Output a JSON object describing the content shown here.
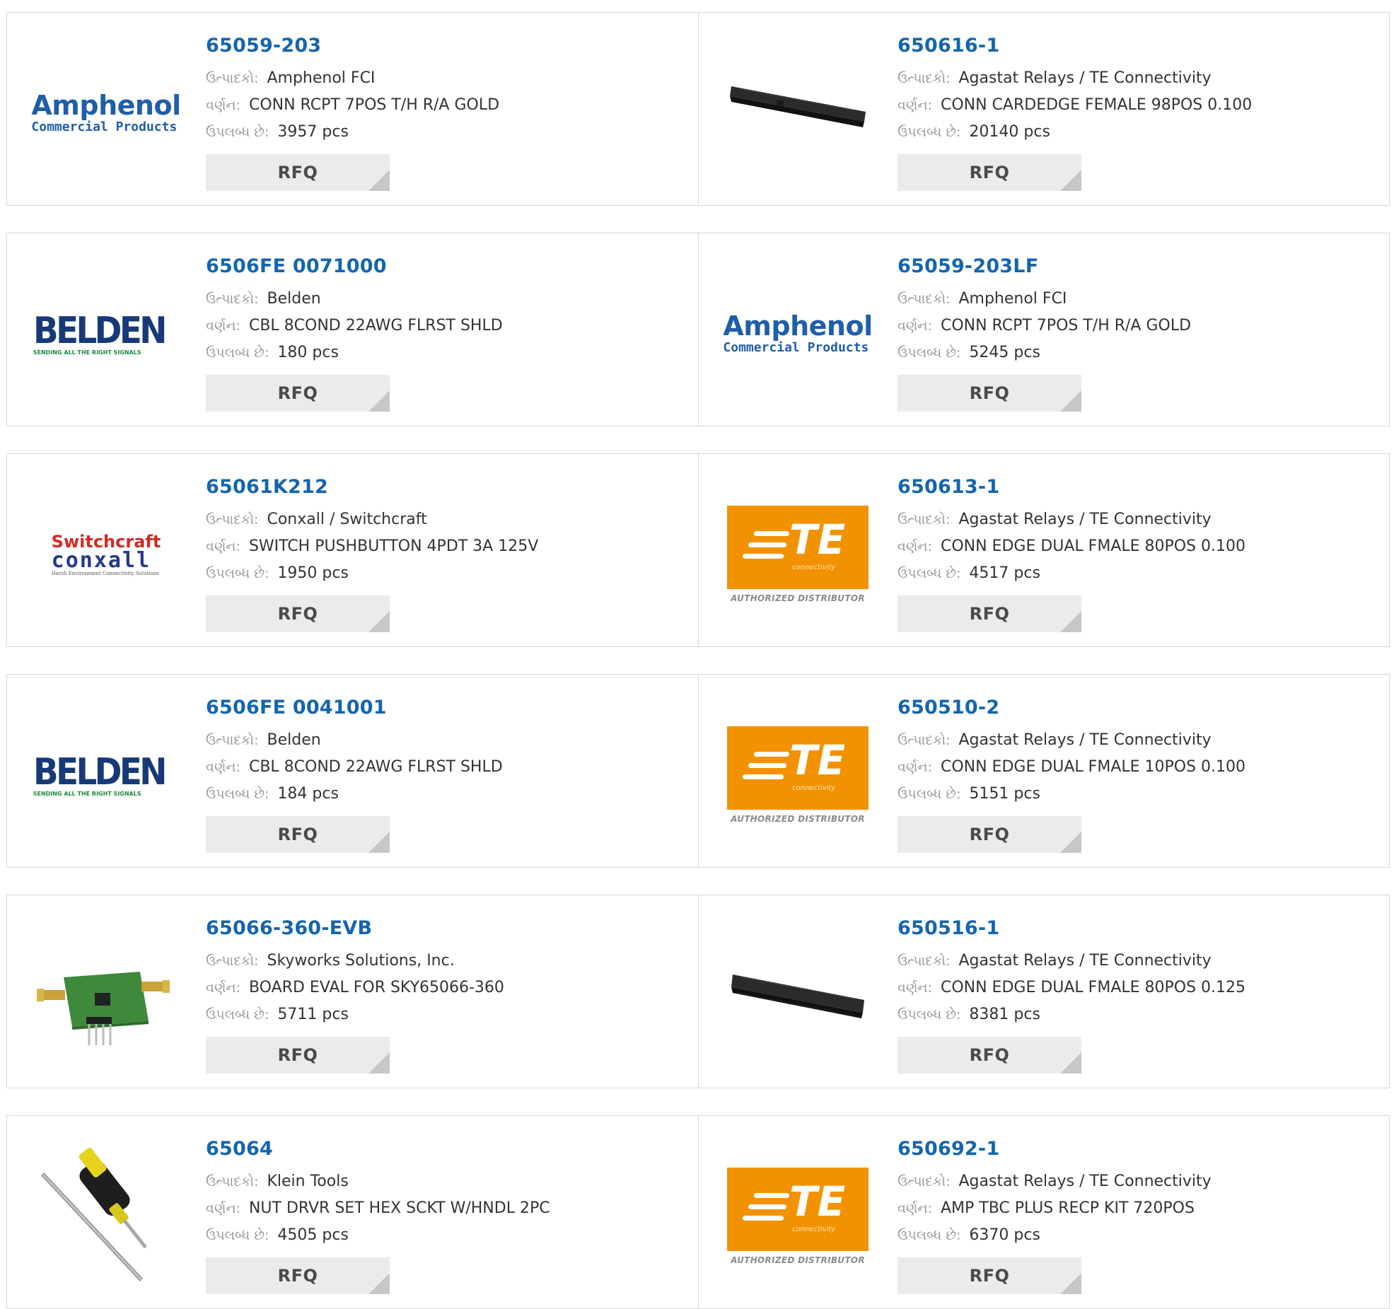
{
  "labels": {
    "manufacturer": "ઉત્પાદકો:",
    "description": "વર્ણન:",
    "availability": "ઉપલબ્ધ છે:",
    "rfq": "RFQ"
  },
  "logos": {
    "amphenol": {
      "line1": "Amphenol",
      "line2": "Commercial Products"
    },
    "belden": {
      "line1": "BELDEN",
      "line2": "SENDING ALL THE RIGHT SIGNALS"
    },
    "switchcraft": {
      "line1": "Switchcraft",
      "line2": "conxall",
      "line3": "Harsh Environment Connectivity Solutions"
    },
    "te": {
      "line1": "TE",
      "line2": "connectivity",
      "line3": "AUTHORIZED DISTRIBUTOR"
    }
  },
  "colors": {
    "link": "#1565ad",
    "te_orange": "#f39200"
  },
  "products": [
    {
      "part": "65059-203",
      "manufacturer": "Amphenol FCI",
      "description": "CONN RCPT 7POS T/H R/A GOLD",
      "stock": "3957 pcs",
      "image": "amphenol-logo"
    },
    {
      "part": "650616-1",
      "manufacturer": "Agastat Relays / TE Connectivity",
      "description": "CONN CARDEDGE FEMALE 98POS 0.100",
      "stock": "20140 pcs",
      "image": "card-edge-connector-photo"
    },
    {
      "part": "6506FE 0071000",
      "manufacturer": "Belden",
      "description": "CBL 8COND 22AWG FLRST SHLD",
      "stock": "180 pcs",
      "image": "belden-logo"
    },
    {
      "part": "65059-203LF",
      "manufacturer": "Amphenol FCI",
      "description": "CONN RCPT 7POS T/H R/A GOLD",
      "stock": "5245 pcs",
      "image": "amphenol-logo"
    },
    {
      "part": "65061K212",
      "manufacturer": "Conxall / Switchcraft",
      "description": "SWITCH PUSHBUTTON 4PDT 3A 125V",
      "stock": "1950 pcs",
      "image": "switchcraft-logo"
    },
    {
      "part": "650613-1",
      "manufacturer": "Agastat Relays / TE Connectivity",
      "description": "CONN EDGE DUAL FMALE 80POS 0.100",
      "stock": "4517 pcs",
      "image": "te-logo"
    },
    {
      "part": "6506FE 0041001",
      "manufacturer": "Belden",
      "description": "CBL 8COND 22AWG FLRST SHLD",
      "stock": "184 pcs",
      "image": "belden-logo"
    },
    {
      "part": "650510-2",
      "manufacturer": "Agastat Relays / TE Connectivity",
      "description": "CONN EDGE DUAL FMALE 10POS 0.100",
      "stock": "5151 pcs",
      "image": "te-logo"
    },
    {
      "part": "65066-360-EVB",
      "manufacturer": "Skyworks Solutions, Inc.",
      "description": "BOARD EVAL FOR SKY65066-360",
      "stock": "5711 pcs",
      "image": "eval-board-photo"
    },
    {
      "part": "650516-1",
      "manufacturer": "Agastat Relays / TE Connectivity",
      "description": "CONN EDGE DUAL FMALE 80POS 0.125",
      "stock": "8381 pcs",
      "image": "card-edge-connector-photo"
    },
    {
      "part": "65064",
      "manufacturer": "Klein Tools",
      "description": "NUT DRVR SET HEX SCKT W/HNDL 2PC",
      "stock": "4505 pcs",
      "image": "nut-driver-photo"
    },
    {
      "part": "650692-1",
      "manufacturer": "Agastat Relays / TE Connectivity",
      "description": "AMP TBC PLUS RECP KIT 720POS",
      "stock": "6370 pcs",
      "image": "te-logo"
    }
  ]
}
